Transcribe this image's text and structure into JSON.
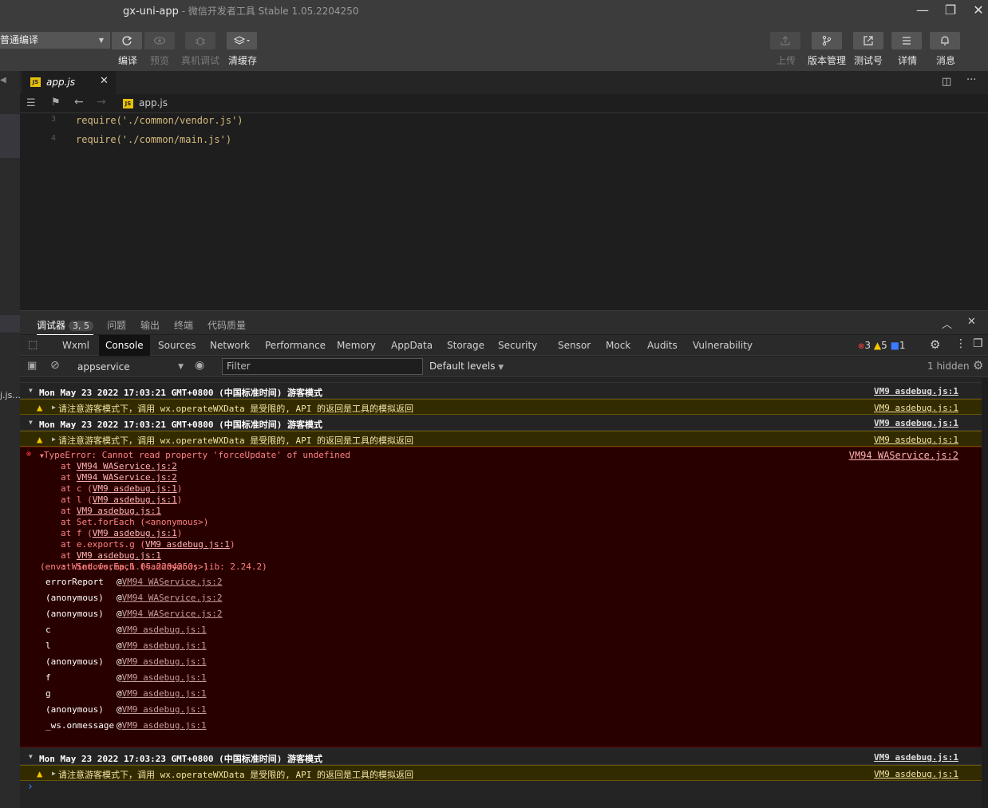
{
  "window": {
    "app_name": "gx-uni-app",
    "subtitle": " - 微信开发者工具 Stable 1.05.2204250",
    "minimize_glyph": "—",
    "restore_glyph": "❐",
    "close_glyph": "✕"
  },
  "toolbar": {
    "compile_mode": "普通编译",
    "compile_label": "编译",
    "preview_label": "预览",
    "device_debug_label": "真机调试",
    "clear_cache_label": "清缓存",
    "upload_label": "上传",
    "version_label": "版本管理",
    "test_label": "测试号",
    "detail_label": "详情",
    "message_label": "消息"
  },
  "editor": {
    "tab_title": "app.js",
    "breadcrumb_file": "app.js",
    "lines": [
      {
        "num": "3",
        "code": "require('./common/vendor.js')"
      },
      {
        "num": "4",
        "code": "require('./common/main.js')"
      }
    ]
  },
  "left_strip": {
    "truncated_file": "j.js..."
  },
  "debugger": {
    "tabs": [
      "调试器",
      "问题",
      "输出",
      "终端",
      "代码质量"
    ],
    "badge": "3, 5"
  },
  "devtools": {
    "tabs": [
      "Wxml",
      "Console",
      "Sources",
      "Network",
      "Performance",
      "Memory",
      "AppData",
      "Storage",
      "Security",
      "Sensor",
      "Mock",
      "Audits",
      "Vulnerability"
    ],
    "active_tab": "Console",
    "error_count": "3",
    "warning_count": "5",
    "info_count": "1"
  },
  "filterbar": {
    "context": "appservice",
    "filter_placeholder": "Filter",
    "levels": "Default levels",
    "hidden": "1 hidden"
  },
  "console": {
    "group1": {
      "text": "Mon May 23 2022 17:03:21 GMT+0800 (中国标准时间) 游客模式",
      "src": "VM9 asdebug.js:1"
    },
    "warn1": {
      "text": "请注意游客模式下，调用 wx.operateWXData 是受限的, API 的返回是工具的模拟返回",
      "src": "VM9 asdebug.js:1"
    },
    "group2": {
      "text": "Mon May 23 2022 17:03:21 GMT+0800 (中国标准时间) 游客模式",
      "src": "VM9 asdebug.js:1"
    },
    "warn2": {
      "text": "请注意游客模式下，调用 wx.operateWXData 是受限的, API 的返回是工具的模拟返回",
      "src": "VM9 asdebug.js:1"
    },
    "error": {
      "message": "TypeError: Cannot read property 'forceUpdate' of undefined",
      "src": "VM94 WAService.js:2",
      "stack": [
        {
          "prefix": "at ",
          "link": "VM94 WAService.js:2",
          "suffix": ""
        },
        {
          "prefix": "at ",
          "link": "VM94 WAService.js:2",
          "suffix": ""
        },
        {
          "prefix": "at c (",
          "link": "VM9 asdebug.js:1",
          "suffix": ")"
        },
        {
          "prefix": "at l (",
          "link": "VM9 asdebug.js:1",
          "suffix": ")"
        },
        {
          "prefix": "at ",
          "link": "VM9 asdebug.js:1",
          "suffix": ""
        },
        {
          "prefix": "at Set.forEach (<anonymous>)",
          "link": "",
          "suffix": ""
        },
        {
          "prefix": "at f (",
          "link": "VM9 asdebug.js:1",
          "suffix": ")"
        },
        {
          "prefix": "at e.exports.g (",
          "link": "VM9 asdebug.js:1",
          "suffix": ")"
        },
        {
          "prefix": "at ",
          "link": "VM9 asdebug.js:1",
          "suffix": ""
        },
        {
          "prefix": "at Set.forEach (<anonymous>)",
          "link": "",
          "suffix": ""
        }
      ],
      "env": "(env: Windows,mp,1.05.2204250; lib: 2.24.2)",
      "trace": [
        {
          "fn": "errorReport",
          "loc": "VM94 WAService.js:2"
        },
        {
          "fn": "(anonymous)",
          "loc": "VM94 WAService.js:2"
        },
        {
          "fn": "(anonymous)",
          "loc": "VM94 WAService.js:2"
        },
        {
          "fn": "c",
          "loc": "VM9 asdebug.js:1"
        },
        {
          "fn": "l",
          "loc": "VM9 asdebug.js:1"
        },
        {
          "fn": "(anonymous)",
          "loc": "VM9 asdebug.js:1"
        },
        {
          "fn": "f",
          "loc": "VM9 asdebug.js:1"
        },
        {
          "fn": "g",
          "loc": "VM9 asdebug.js:1"
        },
        {
          "fn": "(anonymous)",
          "loc": "VM9 asdebug.js:1"
        },
        {
          "fn": "_ws.onmessage",
          "loc": "VM9 asdebug.js:1"
        }
      ]
    },
    "group3": {
      "text": "Mon May 23 2022 17:03:23 GMT+0800 (中国标准时间) 游客模式",
      "src": "VM9 asdebug.js:1"
    },
    "warn3": {
      "text": "请注意游客模式下，调用 wx.operateWXData 是受限的, API 的返回是工具的模拟返回",
      "src": "VM9 asdebug.js:1"
    },
    "prompt": "›"
  }
}
